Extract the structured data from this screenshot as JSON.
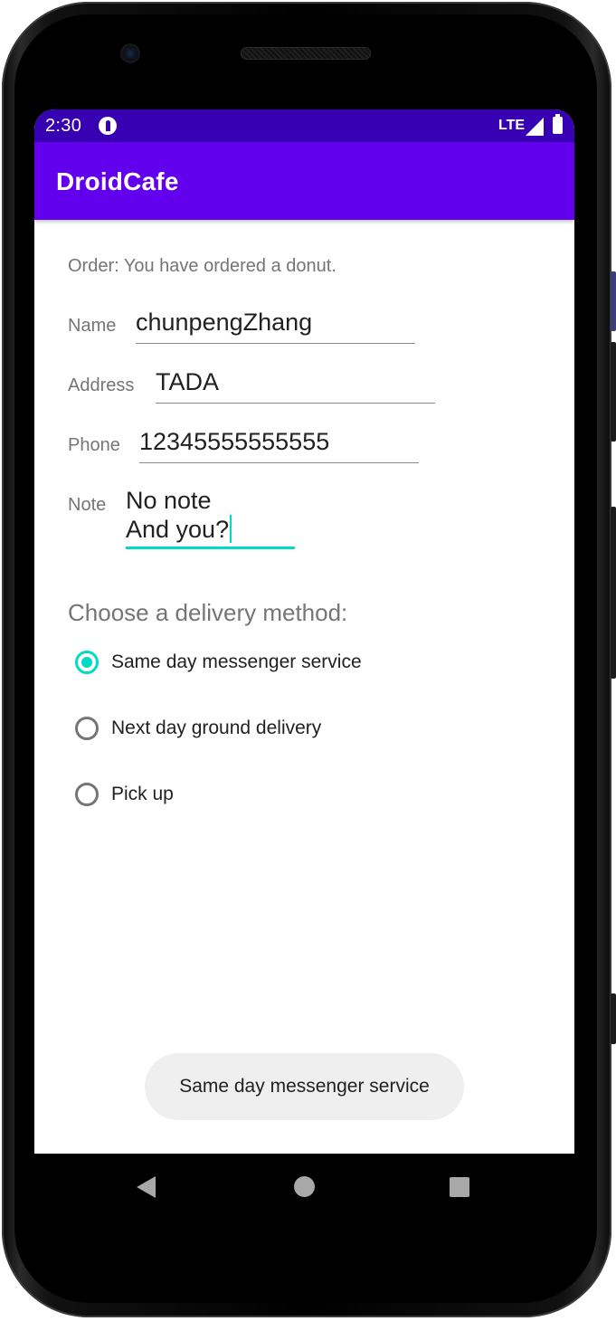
{
  "status_bar": {
    "time": "2:30",
    "network": "LTE",
    "notification_icon": "app-notification-icon",
    "signal_icon": "cell-signal-icon",
    "battery_icon": "battery-icon",
    "color": "#3700b3"
  },
  "app_bar": {
    "title": "DroidCafe",
    "color": "#6200ee"
  },
  "order": {
    "message": "Order: You have ordered a donut."
  },
  "form": {
    "name": {
      "label": "Name",
      "value": "chunpengZhang"
    },
    "address": {
      "label": "Address",
      "value": "TADA"
    },
    "phone": {
      "label": "Phone",
      "value": "12345555555555"
    },
    "note": {
      "label": "Note",
      "lines": [
        "No note",
        "And you?"
      ]
    }
  },
  "delivery": {
    "title": "Choose a delivery method:",
    "options": [
      {
        "label": "Same day messenger service",
        "checked": true
      },
      {
        "label": "Next day ground delivery",
        "checked": false
      },
      {
        "label": "Pick up",
        "checked": false
      }
    ],
    "accent_color": "#03dac5"
  },
  "toast": {
    "message": "Same day messenger service"
  },
  "nav_bar": {
    "back_icon": "back-triangle-icon",
    "home_icon": "home-circle-icon",
    "recents_icon": "recents-square-icon"
  }
}
